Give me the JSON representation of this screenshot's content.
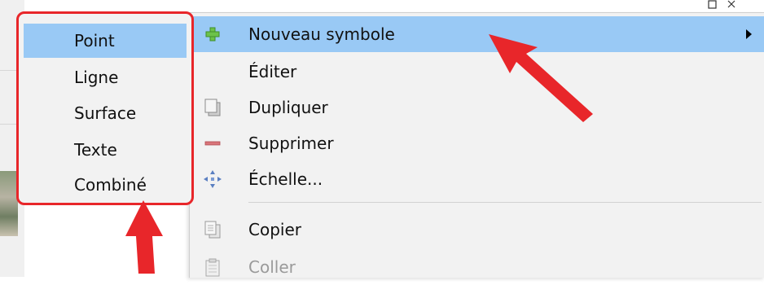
{
  "main_menu": {
    "items": [
      {
        "label": "Nouveau symbole",
        "icon": "plus-icon",
        "highlighted": true,
        "has_submenu": true,
        "disabled": false
      },
      {
        "label": "Éditer",
        "icon": "",
        "highlighted": false,
        "has_submenu": false,
        "disabled": false
      },
      {
        "label": "Dupliquer",
        "icon": "duplicate-icon",
        "highlighted": false,
        "has_submenu": false,
        "disabled": false
      },
      {
        "label": "Supprimer",
        "icon": "minus-icon",
        "highlighted": false,
        "has_submenu": false,
        "disabled": false
      },
      {
        "label": "Échelle...",
        "icon": "scale-arrows-icon",
        "highlighted": false,
        "has_submenu": false,
        "disabled": false
      },
      {
        "label": "Copier",
        "icon": "copy-icon",
        "highlighted": false,
        "has_submenu": false,
        "disabled": false
      },
      {
        "label": "Coller",
        "icon": "paste-icon",
        "highlighted": false,
        "has_submenu": false,
        "disabled": true
      }
    ]
  },
  "sub_menu": {
    "items": [
      {
        "label": "Point",
        "highlighted": true
      },
      {
        "label": "Ligne",
        "highlighted": false
      },
      {
        "label": "Surface",
        "highlighted": false
      },
      {
        "label": "Texte",
        "highlighted": false
      },
      {
        "label": "Combiné",
        "highlighted": false
      }
    ]
  },
  "colors": {
    "highlight": "#99c9f5",
    "annotation_red": "#e8262a",
    "menu_bg": "#f2f2f2"
  }
}
